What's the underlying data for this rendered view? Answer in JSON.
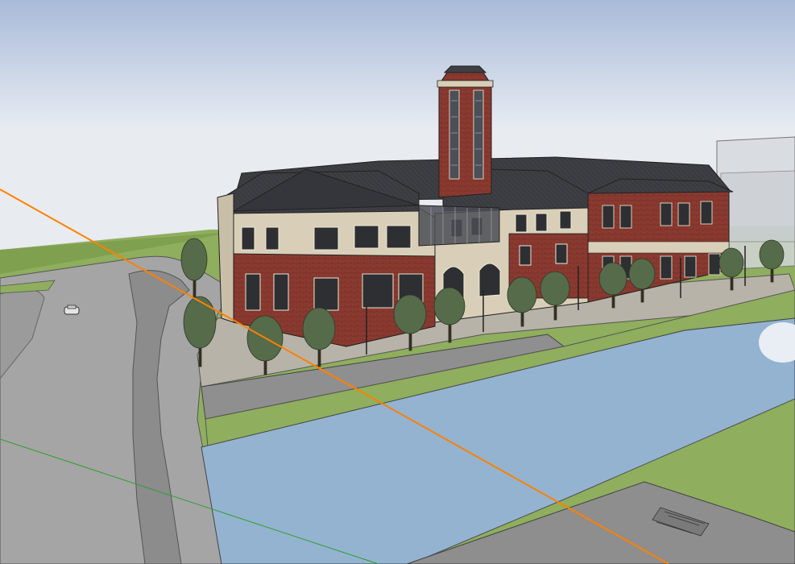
{
  "scene": {
    "type": "3d-model-viewport",
    "subject": "urban-building-complex-with-clock-tower",
    "colors": {
      "sky_top": "#a9bbd9",
      "sky_bottom": "#e9edf3",
      "grass": "#8fae5e",
      "grass_dark": "#7d9b4f",
      "road": "#a5a5a5",
      "road_dark": "#8c8c8c",
      "water": "#93b3d0",
      "brick": "#8a3a30",
      "stone": "#d9cfb9",
      "roof": "#3e3f44",
      "axis_red_orange": "#ff8000",
      "axis_green": "#2ca02c"
    }
  }
}
